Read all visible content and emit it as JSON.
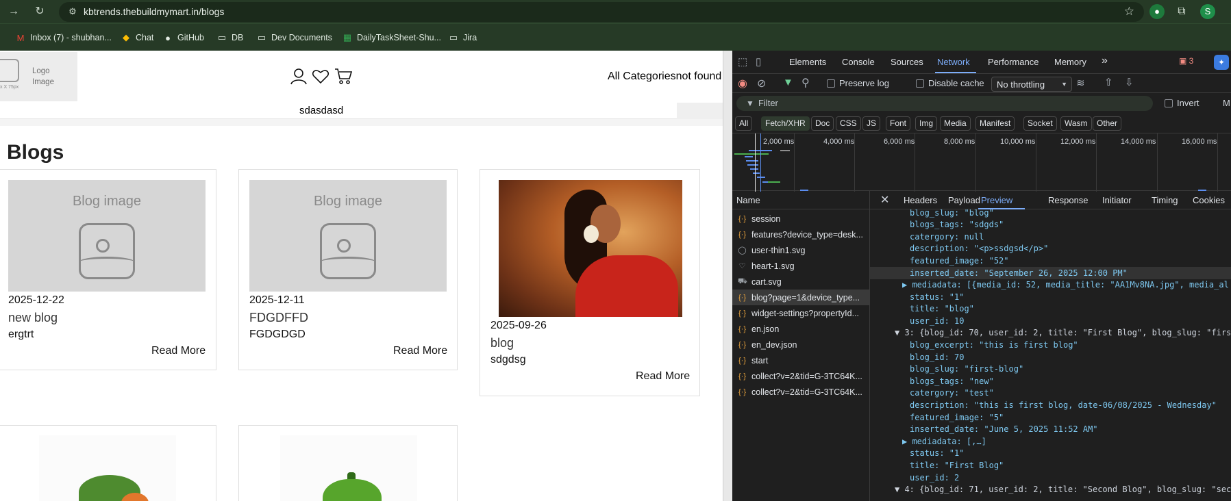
{
  "browser": {
    "url": "kbtrends.thebuildmymart.in/blogs",
    "bookmarks": [
      "Inbox (7) - shubhan...",
      "Chat",
      "GitHub",
      "DB",
      "Dev Documents",
      "DailyTaskSheet-Shu...",
      "Jira"
    ],
    "profile_initial": "S"
  },
  "site": {
    "logo_text": "Logo Image",
    "logo_size": "x X 75px",
    "all_categories": "All Categoriesnot found",
    "search_text": "sdasdasd",
    "page_title": "Blogs",
    "placeholder_label": "Blog image",
    "read_more": "Read More",
    "cards": [
      {
        "date": "2025-12-22",
        "title": "new blog",
        "excerpt": "ergtrt"
      },
      {
        "date": "2025-12-11",
        "title": "FDGDFFD",
        "excerpt": "FGDGDGD"
      },
      {
        "date": "2025-09-26",
        "title": "blog",
        "excerpt": "sdgdsg"
      }
    ]
  },
  "devtools": {
    "tabs": [
      "Elements",
      "Console",
      "Sources",
      "Network",
      "Performance",
      "Memory"
    ],
    "more_tabs": "»",
    "issues_count": "3",
    "toolbar": {
      "preserve_log": "Preserve log",
      "disable_cache": "Disable cache",
      "throttling": "No throttling"
    },
    "filter_placeholder": "Filter",
    "invert": "Invert",
    "more_filters": "M",
    "type_filters": [
      "All",
      "Fetch/XHR",
      "Doc",
      "CSS",
      "JS",
      "Font",
      "Img",
      "Media",
      "Manifest",
      "Socket",
      "Wasm",
      "Other"
    ],
    "timeline_labels": [
      "2,000 ms",
      "4,000 ms",
      "6,000 ms",
      "8,000 ms",
      "10,000 ms",
      "12,000 ms",
      "14,000 ms",
      "16,000 ms"
    ],
    "name_header": "Name",
    "requests": [
      "session",
      "features?device_type=desk...",
      "user-thin1.svg",
      "heart-1.svg",
      "cart.svg",
      "blog?page=1&device_type...",
      "widget-settings?propertyId...",
      "en.json",
      "en_dev.json",
      "start",
      "collect?v=2&tid=G-3TC64K...",
      "collect?v=2&tid=G-3TC64K..."
    ],
    "detail_tabs": [
      "Headers",
      "Payload",
      "Preview",
      "Response",
      "Initiator",
      "Timing",
      "Cookies"
    ],
    "preview_lines": [
      "blog_slug: \"blog\"",
      "blogs_tags: \"sdgds\"",
      "catergory: null",
      "description: \"<p>ssdgsd</p>\"",
      "featured_image: \"52\"",
      "inserted_date: \"September 26, 2025 12:00 PM\"",
      "▶ mediadata: [{media_id: 52, media_title: \"AA1Mv8NA.jpg\", media_al",
      "status: \"1\"",
      "title: \"blog\"",
      "user_id: 10",
      "▼ 3: {blog_id: 70, user_id: 2, title: \"First Blog\", blog_slug: \"firs",
      "blog_excerpt: \"this is first blog\"",
      "blog_id: 70",
      "blog_slug: \"first-blog\"",
      "blogs_tags: \"new\"",
      "catergory: \"test\"",
      "description: \"this is first blog, date-06/08/2025 - Wednesday\"",
      "featured_image: \"5\"",
      "inserted_date: \"June 5, 2025 11:52 AM\"",
      "▶ mediadata: [,…]",
      "status: \"1\"",
      "title: \"First Blog\"",
      "user_id: 2",
      "▼ 4: {blog_id: 71, user_id: 2, title: \"Second Blog\", blog_slug: \"sec"
    ]
  }
}
